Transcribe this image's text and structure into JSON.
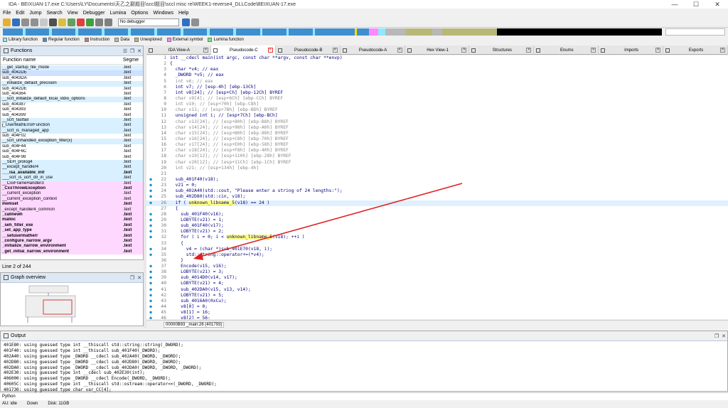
{
  "window": {
    "title": "IDA - BEIXUAN-17.exe C:\\Users\\LY\\Documents\\天乙之巅题目\\sccl题目\\sccl misc re\\WEEK1-reverse4_DLLCode\\BEIXUAN-17.exe",
    "minimize": "—",
    "maximize": "☐",
    "close": "✕"
  },
  "menu": [
    "File",
    "Edit",
    "Jump",
    "Search",
    "View",
    "Debugger",
    "Lumina",
    "Options",
    "Windows",
    "Help"
  ],
  "toolbar": {
    "debugger_select": "No debugger"
  },
  "legend": [
    {
      "label": "Library function",
      "color": "#8ee8ff"
    },
    {
      "label": "Regular function",
      "color": "#3f8fd0"
    },
    {
      "label": "Instruction",
      "color": "#c07878"
    },
    {
      "label": "Data",
      "color": "#b8b8b8"
    },
    {
      "label": "Unexplored",
      "color": "#b8b878"
    },
    {
      "label": "External symbol",
      "color": "#ff88ff"
    },
    {
      "label": "Lumina function",
      "color": "#78e878"
    }
  ],
  "functions_panel": {
    "title": "Functions",
    "col_name": "Function name",
    "col_segment": "Segme",
    "status": "Line 2 of 244",
    "rows": [
      {
        "name": "__get_startup_file_mode",
        "seg": ".text",
        "style": "lib"
      },
      {
        "name": "sub_4042DE",
        "seg": ".text",
        "style": "sel"
      },
      {
        "name": "sub_4043DA",
        "seg": ".text",
        "style": ""
      },
      {
        "name": "__initialize_default_precision",
        "seg": ".text",
        "style": "lib"
      },
      {
        "name": "sub_4042DE",
        "seg": ".text",
        "style": ""
      },
      {
        "name": "sub_404364",
        "seg": ".text",
        "style": ""
      },
      {
        "name": "__scrt_initialize_default_local_stdio_options",
        "seg": ".text",
        "style": "lib"
      },
      {
        "name": "sub_404387",
        "seg": ".text",
        "style": ""
      },
      {
        "name": "sub_404393",
        "seg": ".text",
        "style": ""
      },
      {
        "name": "sub_404399",
        "seg": ".text",
        "style": ""
      },
      {
        "name": "__scrt_fastfail",
        "seg": ".text",
        "style": "lib"
      },
      {
        "name": "j_UserMathErrorFunction",
        "seg": ".text",
        "style": "lib"
      },
      {
        "name": "__scrt_is_managed_app",
        "seg": ".text",
        "style": "lib"
      },
      {
        "name": "sub_404F02",
        "seg": ".text",
        "style": ""
      },
      {
        "name": "__scrt_unhandled_exception_filter(x)",
        "seg": ".text",
        "style": "lib"
      },
      {
        "name": "sub_404F44",
        "seg": ".text",
        "style": ""
      },
      {
        "name": "sub_404F6C",
        "seg": ".text",
        "style": ""
      },
      {
        "name": "sub_404F98",
        "seg": ".text",
        "style": ""
      },
      {
        "name": "__SEH_prolog4",
        "seg": ".text",
        "style": "lib"
      },
      {
        "name": "__except_handler4",
        "seg": ".text",
        "style": "lib"
      },
      {
        "name": "___isa_available_init",
        "seg": ".text",
        "style": "lib b"
      },
      {
        "name": "___scrt_is_ucrt_dll_in_use",
        "seg": ".text",
        "style": "lib"
      },
      {
        "name": "__CxxFrameHandler3",
        "seg": ".text",
        "style": "pink"
      },
      {
        "name": "_CxxThrowException",
        "seg": ".text",
        "style": "pink b"
      },
      {
        "name": "__current_exception",
        "seg": ".text",
        "style": "pink"
      },
      {
        "name": "__current_exception_context",
        "seg": ".text",
        "style": "pink"
      },
      {
        "name": "memset",
        "seg": ".text",
        "style": "pink b"
      },
      {
        "name": "_except_handler4_common",
        "seg": ".text",
        "style": "pink"
      },
      {
        "name": "_callnewh",
        "seg": ".text",
        "style": "pink b"
      },
      {
        "name": "malloc",
        "seg": ".text",
        "style": "pink b"
      },
      {
        "name": "_seh_filter_exe",
        "seg": ".text",
        "style": "pink b"
      },
      {
        "name": "_set_app_type",
        "seg": ".text",
        "style": "pink b"
      },
      {
        "name": "__setusermatherr",
        "seg": ".text",
        "style": "pink b"
      },
      {
        "name": "_configure_narrow_argv",
        "seg": ".text",
        "style": "pink b"
      },
      {
        "name": "_initialize_narrow_environment",
        "seg": ".text",
        "style": "pink b"
      },
      {
        "name": "_get_initial_narrow_environment",
        "seg": ".text",
        "style": "pink b"
      }
    ]
  },
  "graph_panel": {
    "title": "Graph overview"
  },
  "tabs": [
    {
      "label": "IDA View-A",
      "active": false
    },
    {
      "label": "Pseudocode-C",
      "active": true
    },
    {
      "label": "Pseudocode-B",
      "active": false
    },
    {
      "label": "Pseudocode-A",
      "active": false
    },
    {
      "label": "Hex View-1",
      "active": false
    },
    {
      "label": "Structures",
      "active": false
    },
    {
      "label": "Enums",
      "active": false
    },
    {
      "label": "Imports",
      "active": false
    },
    {
      "label": "Exports",
      "active": false
    }
  ],
  "code_lines": [
    {
      "n": "1",
      "t": "int __cdecl main(int argc, const char **argv, const char **envp)",
      "dot": false,
      "c": ""
    },
    {
      "n": "2",
      "t": "{",
      "dot": false,
      "c": ""
    },
    {
      "n": "3",
      "t": "  char *v4; // eax",
      "dot": false,
      "c": ""
    },
    {
      "n": "4",
      "t": "  _DWORD *v5; // eax",
      "dot": false,
      "c": ""
    },
    {
      "n": "5",
      "t": "  int v6; // eax",
      "dot": false,
      "c": "gray"
    },
    {
      "n": "6",
      "t": "  int v7; // [esp-4h] [ebp-13Ch]",
      "dot": false,
      "c": ""
    },
    {
      "n": "7",
      "t": "  int v8[24]; // [esp+Ch] [ebp-12Ch] BYREF",
      "dot": false,
      "c": ""
    },
    {
      "n": "8",
      "t": "  char v9[4]; // [esp+6Ch] [ebp-CCh] BYREF",
      "dot": false,
      "c": "gray"
    },
    {
      "n": "9",
      "t": "  int v10; // [esp+70h] [ebp-C8h]",
      "dot": false,
      "c": "gray"
    },
    {
      "n": "10",
      "t": "  char v11; // [esp+7Bh] [ebp-BDh] BYREF",
      "dot": false,
      "c": "gray"
    },
    {
      "n": "11",
      "t": "  unsigned int i; // [esp+7Ch] [ebp-BCh]",
      "dot": false,
      "c": ""
    },
    {
      "n": "12",
      "t": "  char v13[24]; // [esp+80h] [ebp-B8h] BYREF",
      "dot": false,
      "c": "gray"
    },
    {
      "n": "13",
      "t": "  char v14[24]; // [esp+98h] [ebp-A0h] BYREF",
      "dot": false,
      "c": "gray"
    },
    {
      "n": "14",
      "t": "  char v15[24]; // [esp+B0h] [ebp-88h] BYREF",
      "dot": false,
      "c": "gray"
    },
    {
      "n": "15",
      "t": "  char v16[24]; // [esp+C8h] [ebp-70h] BYREF",
      "dot": false,
      "c": "gray"
    },
    {
      "n": "16",
      "t": "  char v17[24]; // [esp+E0h] [ebp-58h] BYREF",
      "dot": false,
      "c": "gray"
    },
    {
      "n": "17",
      "t": "  char v18[24]; // [esp+F8h] [ebp-40h] BYREF",
      "dot": false,
      "c": "gray"
    },
    {
      "n": "18",
      "t": "  char v19[12]; // [esp+110h] [ebp-28h] BYREF",
      "dot": false,
      "c": "gray"
    },
    {
      "n": "19",
      "t": "  char v20[12]; // [esp+11Ch] [ebp-1Ch] BYREF",
      "dot": false,
      "c": "gray"
    },
    {
      "n": "20",
      "t": "  int v21; // [esp+134h] [ebp-4h]",
      "dot": false,
      "c": "gray"
    },
    {
      "n": "21",
      "t": "",
      "dot": false,
      "c": ""
    },
    {
      "n": "22",
      "t": "  sub_401F40(v18);",
      "dot": true,
      "c": ""
    },
    {
      "n": "23",
      "t": "  v21 = 0;",
      "dot": true,
      "c": ""
    },
    {
      "n": "24",
      "t": "  sub_402A40(std::cout, \"Please enter a string of 24 lengths:\");",
      "dot": true,
      "c": ""
    },
    {
      "n": "25",
      "t": "  sub_402D80(std::cin, v18);",
      "dot": true,
      "c": ""
    },
    {
      "n": "26",
      "t": "  if ( unknown_libname_5(v18) == 24 )",
      "dot": true,
      "c": "hl"
    },
    {
      "n": "27",
      "t": "  {",
      "dot": false,
      "c": ""
    },
    {
      "n": "28",
      "t": "    sub_401F40(v16);",
      "dot": true,
      "c": ""
    },
    {
      "n": "29",
      "t": "    LOBYTE(v21) = 1;",
      "dot": true,
      "c": ""
    },
    {
      "n": "30",
      "t": "    sub_401F40(v17);",
      "dot": true,
      "c": ""
    },
    {
      "n": "31",
      "t": "    LOBYTE(v21) = 2;",
      "dot": true,
      "c": ""
    },
    {
      "n": "32",
      "t": "    for ( i = 0; i < unknown_libname_5(v18); ++i )",
      "dot": true,
      "c": ""
    },
    {
      "n": "33",
      "t": "    {",
      "dot": false,
      "c": ""
    },
    {
      "n": "34",
      "t": "      v4 = (char *)sub_401E70(v18, i);",
      "dot": true,
      "c": ""
    },
    {
      "n": "35",
      "t": "      std::string::operator+=(*v4);",
      "dot": true,
      "c": ""
    },
    {
      "n": "36",
      "t": "    }",
      "dot": false,
      "c": ""
    },
    {
      "n": "37",
      "t": "    Encode(v15, v16);",
      "dot": true,
      "c": ""
    },
    {
      "n": "38",
      "t": "    LOBYTE(v21) = 3;",
      "dot": true,
      "c": ""
    },
    {
      "n": "39",
      "t": "    sub_4014D0(v14, v17);",
      "dot": true,
      "c": ""
    },
    {
      "n": "40",
      "t": "    LOBYTE(v21) = 4;",
      "dot": true,
      "c": ""
    },
    {
      "n": "41",
      "t": "    sub_402DA0(v15, v13, v14);",
      "dot": true,
      "c": ""
    },
    {
      "n": "42",
      "t": "    LOBYTE(v21) = 5;",
      "dot": true,
      "c": ""
    },
    {
      "n": "43",
      "t": "    sub_4016A0(0xCu);",
      "dot": true,
      "c": ""
    },
    {
      "n": "44",
      "t": "    v8[0] = 0;",
      "dot": true,
      "c": ""
    },
    {
      "n": "45",
      "t": "    v8[1] = 16;",
      "dot": true,
      "c": ""
    },
    {
      "n": "46",
      "t": "    v8[2] = 56;",
      "dot": true,
      "c": ""
    },
    {
      "n": "47",
      "t": "    v8[3] = 19;",
      "dot": true,
      "c": ""
    }
  ],
  "highlight_token": "unknown_libname_5",
  "code_status": "00000B93 _main:26 (401793)",
  "output": {
    "title": "Output",
    "lines": [
      "401E80: using guessed type int __thiscall std::string::string(_DWORD);",
      "401F40: using guessed type int __thiscall sub_401F40(_DWORD);",
      "402A40: using guessed type _DWORD __cdecl sub_402A40(_DWORD, _DWORD);",
      "402D80: using guessed type _DWORD __cdecl sub_402D80(_DWORD, _DWORD);",
      "402DA0: using guessed type _DWORD __cdecl sub_402DA0(_DWORD, _DWORD, _DWORD);",
      "402E30: using guessed type int __cdecl sub_402E30(int);",
      "406000: using guessed type _DWORD __cdecl Encode(_DWORD, _DWORD);",
      "40605C: using guessed type int __thiscall std::ostream::operator<<(_DWORD, _DWORD);",
      "401730: using guessed type char var_CC[4];"
    ]
  },
  "python_label": "Python",
  "statusbar": [
    "AU:  idle",
    "Down",
    "Disk: 11GB"
  ]
}
